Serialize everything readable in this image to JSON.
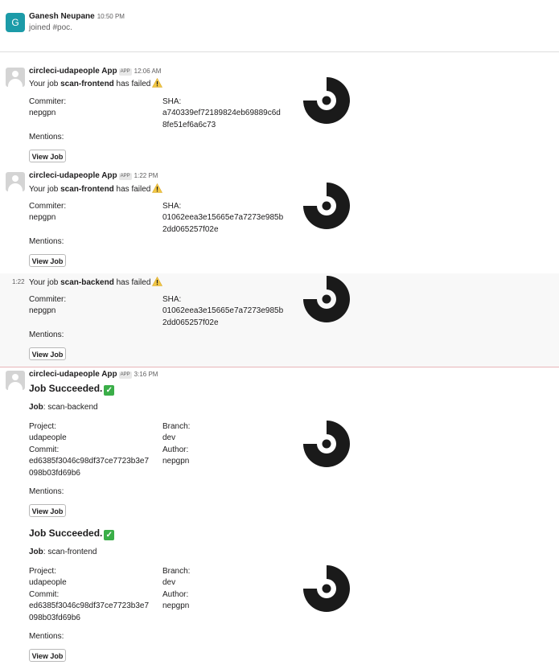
{
  "join_message": {
    "author": "Ganesh Neupane",
    "avatar_letter": "G",
    "avatar_color": "#1c9ba8",
    "time": "10:50 PM",
    "text": "joined #poc."
  },
  "failed_messages": [
    {
      "author": "circleci-udapeople App",
      "badge": "APP",
      "time": "12:06 AM",
      "text_pre": "Your job ",
      "job": "scan-frontend",
      "text_post": " has failed",
      "fields": {
        "commiter_label": "Commiter:",
        "commiter": "nepgpn",
        "sha_label": "SHA:",
        "sha_line1": "a740339ef72189824eb69889c6d",
        "sha_line2": "8fe51ef6a6c73",
        "mentions_label": "Mentions:"
      },
      "button": "View Job"
    },
    {
      "author": "circleci-udapeople App",
      "badge": "APP",
      "time": "1:22 PM",
      "text_pre": "Your job ",
      "job": "scan-frontend",
      "text_post": " has failed",
      "fields": {
        "commiter_label": "Commiter:",
        "commiter": "nepgpn",
        "sha_label": "SHA:",
        "sha_line1": "01062eea3e15665e7a7273e985b",
        "sha_line2": "2dd065257f02e",
        "mentions_label": "Mentions:"
      },
      "button": "View Job"
    },
    {
      "time_short": "1:22",
      "text_pre": "Your job ",
      "job": "scan-backend",
      "text_post": " has failed",
      "fields": {
        "commiter_label": "Commiter:",
        "commiter": "nepgpn",
        "sha_label": "SHA:",
        "sha_line1": "01062eea3e15665e7a7273e985b",
        "sha_line2": "2dd065257f02e",
        "mentions_label": "Mentions:"
      },
      "button": "View Job"
    }
  ],
  "success_message": {
    "author": "circleci-udapeople App",
    "badge": "APP",
    "time": "3:16 PM",
    "blocks": [
      {
        "title": "Job Succeeded.",
        "job_label": "Job",
        "job_value": ": scan-backend",
        "project_label": "Project:",
        "project": "udapeople",
        "branch_label": "Branch:",
        "branch": "dev",
        "commit_label": "Commit:",
        "commit_line1": "ed6385f3046c98df37ce7723b3e7",
        "commit_line2": "098b03fd69b6",
        "author_label": "Author:",
        "author": "nepgpn",
        "mentions_label": "Mentions:",
        "button": "View Job"
      },
      {
        "title": "Job Succeeded.",
        "job_label": "Job",
        "job_value": ": scan-frontend",
        "project_label": "Project:",
        "project": "udapeople",
        "branch_label": "Branch:",
        "branch": "dev",
        "commit_label": "Commit:",
        "commit_line1": "ed6385f3046c98df37ce7723b3e7",
        "commit_line2": "098b03fd69b6",
        "author_label": "Author:",
        "author": "nepgpn",
        "mentions_label": "Mentions:",
        "button": "View Job"
      }
    ]
  },
  "colors": {
    "hover_row": "#f8f8f8",
    "new_divider": "#e8b4b8",
    "success": "#3aae48",
    "warning": "#f2c744"
  },
  "icons": [
    "bot-avatar-icon",
    "warning-icon",
    "check-icon",
    "circleci-logo"
  ]
}
